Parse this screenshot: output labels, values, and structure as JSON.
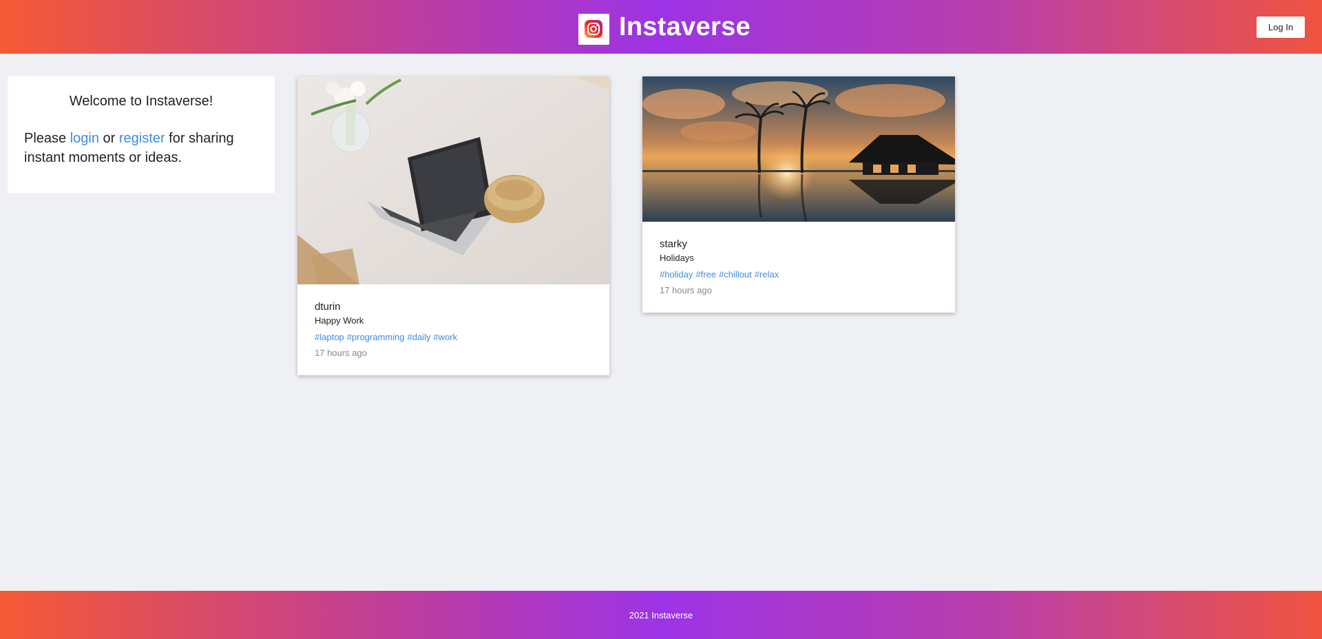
{
  "header": {
    "brand_name": "Instaverse",
    "logo_icon": "instagram-icon",
    "login_label": "Log In"
  },
  "welcome": {
    "title": "Welcome to Instaverse!",
    "text_prefix": "Please ",
    "login_link": "login",
    "text_mid": " or ",
    "register_link": "register",
    "text_suffix": " for sharing instant moments or ideas."
  },
  "posts": [
    {
      "username": "dturin",
      "caption": "Happy Work",
      "tags": [
        "#laptop",
        "#programming",
        "#daily",
        "#work"
      ],
      "time": "17 hours ago"
    },
    {
      "username": "starky",
      "caption": "Holidays",
      "tags": [
        "#holiday",
        "#free",
        "#chillout",
        "#relax"
      ],
      "time": "17 hours ago"
    }
  ],
  "footer": {
    "text": "2021 Instaverse"
  },
  "colors": {
    "link": "#3d8be6",
    "gradient_start": "#f55a34",
    "gradient_mid": "#9d33e6",
    "background": "#eff0f4"
  }
}
